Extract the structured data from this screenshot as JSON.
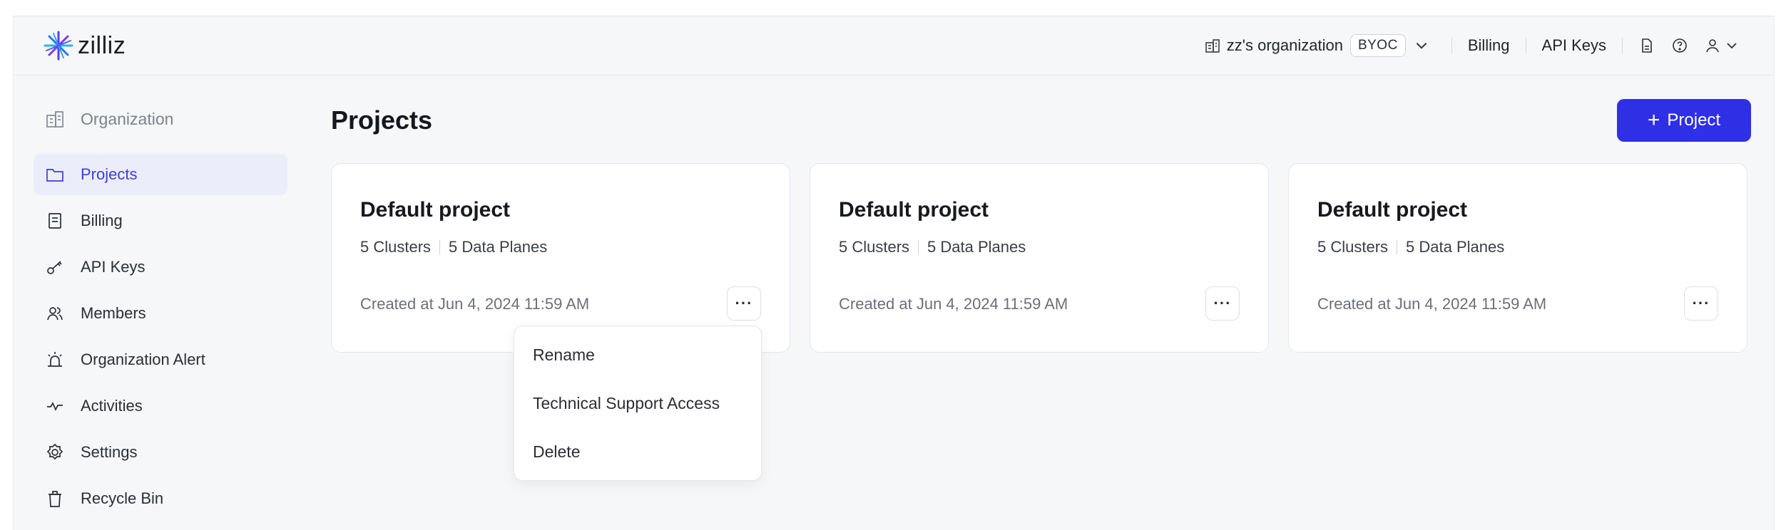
{
  "header": {
    "logo_text": "zilliz",
    "org_name": "zz's organization",
    "org_badge": "BYOC",
    "links": [
      "Billing",
      "API Keys"
    ]
  },
  "sidebar": {
    "items": [
      {
        "label": "Organization",
        "icon": "building-icon"
      },
      {
        "label": "Projects",
        "icon": "folder-icon",
        "active": true
      },
      {
        "label": "Billing",
        "icon": "receipt-icon"
      },
      {
        "label": "API Keys",
        "icon": "key-icon"
      },
      {
        "label": "Members",
        "icon": "members-icon"
      },
      {
        "label": "Organization Alert",
        "icon": "alarm-icon"
      },
      {
        "label": "Activities",
        "icon": "activity-icon"
      },
      {
        "label": "Settings",
        "icon": "gear-icon"
      },
      {
        "label": "Recycle Bin",
        "icon": "trash-icon"
      }
    ]
  },
  "main": {
    "title": "Projects",
    "add_button": "Project",
    "cards": [
      {
        "title": "Default project",
        "clusters": "5 Clusters",
        "planes": "5 Data Planes",
        "created": "Created at Jun 4, 2024 11:59 AM"
      },
      {
        "title": "Default project",
        "clusters": "5 Clusters",
        "planes": "5 Data Planes",
        "created": "Created at Jun 4, 2024 11:59 AM"
      },
      {
        "title": "Default project",
        "clusters": "5 Clusters",
        "planes": "5 Data Planes",
        "created": "Created at Jun 4, 2024 11:59 AM"
      }
    ],
    "more_label": "···"
  },
  "context_menu": {
    "items": [
      "Rename",
      "Technical Support Access",
      "Delete"
    ]
  },
  "colors": {
    "accent": "#2f2fe6",
    "active_bg": "#ecedfb",
    "active_text": "#3b3fd6"
  }
}
